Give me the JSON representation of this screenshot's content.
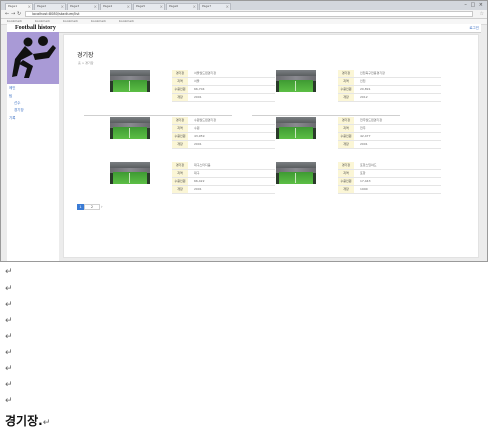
{
  "browser": {
    "tabs": [
      "Page1",
      "Page2",
      "Page3",
      "Page4",
      "Page5",
      "Page6",
      "Page7"
    ],
    "window_buttons": "– □ ×",
    "url": "localhost:8080/stadium/list",
    "bookmarks": [
      "bookmark",
      "bookmark",
      "bookmark",
      "bookmark",
      "bookmark"
    ]
  },
  "site": {
    "brand": "Football history",
    "header_link": "로그인"
  },
  "sidebar": {
    "items": [
      "메인",
      "팀",
      "선수",
      "경기장",
      "기록"
    ]
  },
  "main": {
    "title": "경기장",
    "subtitle": "홈 > 경기장"
  },
  "stadiums": [
    {
      "rows": [
        {
          "label": "경기장",
          "value": "서울월드컵경기장"
        },
        {
          "label": "지역",
          "value": "서울"
        },
        {
          "label": "수용인원",
          "value": "66,704"
        },
        {
          "label": "개장",
          "value": "2001"
        }
      ]
    },
    {
      "rows": [
        {
          "label": "경기장",
          "value": "인천축구전용경기장"
        },
        {
          "label": "지역",
          "value": "인천"
        },
        {
          "label": "수용인원",
          "value": "20,891"
        },
        {
          "label": "개장",
          "value": "2012"
        }
      ]
    },
    {
      "rows": [
        {
          "label": "경기장",
          "value": "수원월드컵경기장"
        },
        {
          "label": "지역",
          "value": "수원"
        },
        {
          "label": "수용인원",
          "value": "43,959"
        },
        {
          "label": "개장",
          "value": "2001"
        }
      ]
    },
    {
      "rows": [
        {
          "label": "경기장",
          "value": "전주월드컵경기장"
        },
        {
          "label": "지역",
          "value": "전주"
        },
        {
          "label": "수용인원",
          "value": "42,477"
        },
        {
          "label": "개장",
          "value": "2001"
        }
      ]
    },
    {
      "rows": [
        {
          "label": "경기장",
          "value": "대구스타디움"
        },
        {
          "label": "지역",
          "value": "대구"
        },
        {
          "label": "수용인원",
          "value": "66,422"
        },
        {
          "label": "개장",
          "value": "2001"
        }
      ]
    },
    {
      "rows": [
        {
          "label": "경기장",
          "value": "포항스틸야드"
        },
        {
          "label": "지역",
          "value": "포항"
        },
        {
          "label": "수용인원",
          "value": "17,443"
        },
        {
          "label": "개장",
          "value": "1990"
        }
      ]
    }
  ],
  "pagination": {
    "current": "1",
    "next": "2",
    "arrow": "›"
  },
  "document": {
    "paragraph_mark": "↵",
    "caption": "경기장."
  }
}
